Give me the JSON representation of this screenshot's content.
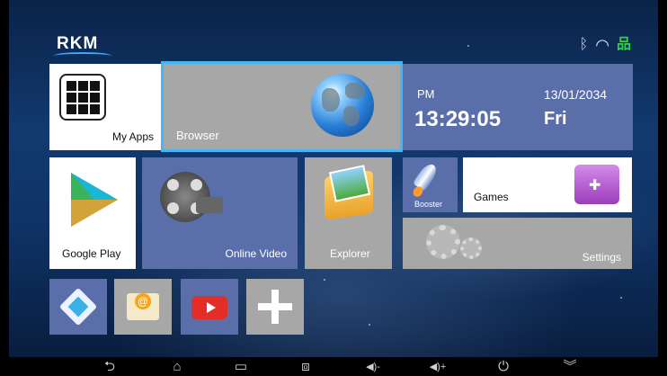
{
  "brand": {
    "logo_text": "RKM"
  },
  "status_bar": {
    "icons": [
      "bluetooth-icon",
      "wifi-icon",
      "ethernet-icon"
    ],
    "bluetooth_glyph": "ᛒ",
    "wifi_glyph": "◠",
    "ethernet_glyph": "品",
    "ethernet_color": "#2fd04a"
  },
  "tiles": {
    "my_apps": {
      "label": "My Apps"
    },
    "browser": {
      "label": "Browser"
    },
    "clock": {
      "ampm": "PM",
      "time": "13:29:05",
      "date": "13/01/2034",
      "day": "Fri"
    },
    "google_play": {
      "label": "Google Play"
    },
    "online_video": {
      "label": "Online Video"
    },
    "explorer": {
      "label": "Explorer"
    },
    "booster": {
      "label": "Booster"
    },
    "games": {
      "label": "Games"
    },
    "settings": {
      "label": "Settings"
    },
    "kodi": {
      "icon": "kodi-icon"
    },
    "email": {
      "icon": "email-icon",
      "glyph": "@"
    },
    "youtube": {
      "icon": "youtube-icon"
    },
    "add_app": {
      "icon": "plus-icon"
    }
  },
  "navbar": {
    "back": "⮌",
    "home": "⌂",
    "recent": "▭",
    "screenshot": "⧈",
    "volume_down": "◀)-",
    "volume_up": "◀)+",
    "power": "⏻",
    "collapse": "︾"
  },
  "colors": {
    "accent_border": "#42b7f7",
    "tile_blue": "#5a6faa",
    "tile_gray": "#a7a7a7"
  }
}
